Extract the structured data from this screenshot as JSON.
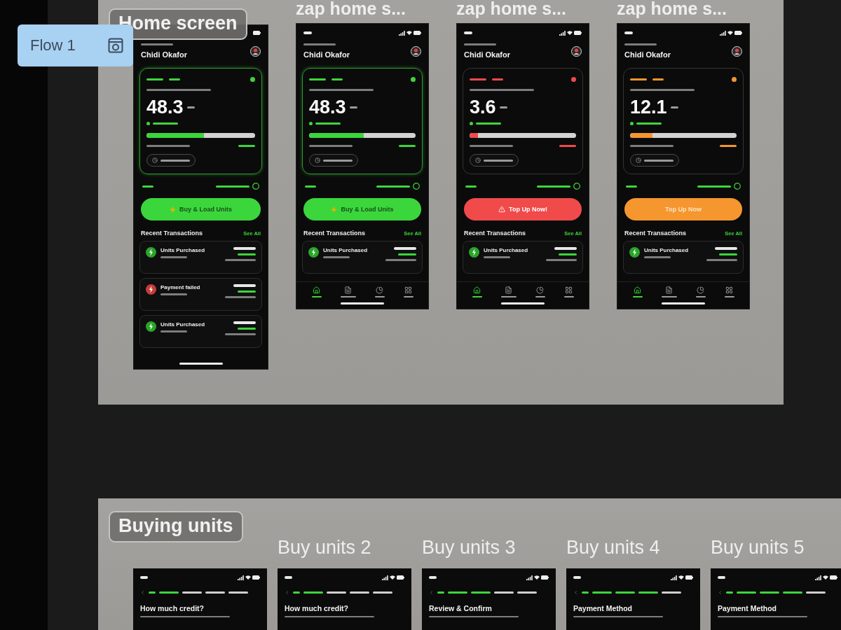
{
  "flow_chip": {
    "label": "Flow 1"
  },
  "home_section": {
    "label": "Home screen",
    "frames": [
      {
        "name": "Chidi Okafor",
        "color": "#3bd63b",
        "highlighted": true,
        "reading": "48.3",
        "level": 0.53,
        "button": {
          "kind": "buy",
          "label": "Buy & Load Units"
        },
        "list_title": "Recent Transactions",
        "see_all": "See All",
        "transactions": [
          {
            "kind": "success",
            "title": "Units Purchased"
          },
          {
            "kind": "failed",
            "title": "Payment failed"
          },
          {
            "kind": "success",
            "title": "Units Purchased"
          }
        ]
      },
      {
        "title": "zap home s...",
        "name": "Chidi Okafor",
        "color": "#3bd63b",
        "highlighted": true,
        "reading": "48.3",
        "level": 0.51,
        "button": {
          "kind": "buy",
          "label": "Buy & Load Units"
        },
        "list_title": "Recent Transactions",
        "see_all": "See All",
        "transactions": [
          {
            "kind": "success",
            "title": "Units Purchased"
          }
        ],
        "tabs": [
          {
            "selected": true
          },
          {
            "selected": false
          },
          {
            "selected": false
          },
          {
            "selected": false
          }
        ]
      },
      {
        "title": "zap home s...",
        "name": "Chidi Okafor",
        "color": "#f04a4a",
        "highlighted": false,
        "reading": "3.6",
        "level": 0.08,
        "button": {
          "kind": "alert",
          "label": "Top Up Now!"
        },
        "list_title": "Recent Transactions",
        "see_all": "See All",
        "transactions": [
          {
            "kind": "success",
            "title": "Units Purchased"
          }
        ],
        "tabs": [
          {
            "selected": true
          },
          {
            "selected": false
          },
          {
            "selected": false
          },
          {
            "selected": false
          }
        ]
      },
      {
        "title": "zap home s...",
        "name": "Chidi Okafor",
        "color": "#f5962f",
        "highlighted": false,
        "reading": "12.1",
        "level": 0.21,
        "button": {
          "kind": "plain",
          "label": "Top Up Now"
        },
        "list_title": "Recent Transactions",
        "see_all": "See All",
        "transactions": [
          {
            "kind": "success",
            "title": "Units Purchased"
          }
        ],
        "tabs": [
          {
            "selected": true
          },
          {
            "selected": false
          },
          {
            "selected": false
          },
          {
            "selected": false
          }
        ]
      }
    ]
  },
  "buy_section": {
    "label": "Buying units",
    "frames": [
      {
        "heading": "How much credit?",
        "steps": [
          {
            "done": true
          },
          {
            "done": false
          },
          {
            "done": false
          },
          {
            "done": false
          }
        ]
      },
      {
        "title": "Buy units 2",
        "heading": "How much credit?",
        "steps": [
          {
            "done": true
          },
          {
            "done": false
          },
          {
            "done": false
          },
          {
            "done": false
          }
        ]
      },
      {
        "title": "Buy units 3",
        "heading": "Review & Confirm",
        "steps": [
          {
            "done": true
          },
          {
            "done": true
          },
          {
            "done": false
          },
          {
            "done": false
          }
        ]
      },
      {
        "title": "Buy units 4",
        "heading": "Payment Method",
        "steps": [
          {
            "done": true
          },
          {
            "done": true
          },
          {
            "done": true
          },
          {
            "done": false
          }
        ]
      },
      {
        "title": "Buy units 5",
        "heading": "Payment Method",
        "steps": [
          {
            "done": true
          },
          {
            "done": true
          },
          {
            "done": true
          },
          {
            "done": false
          }
        ]
      }
    ]
  }
}
